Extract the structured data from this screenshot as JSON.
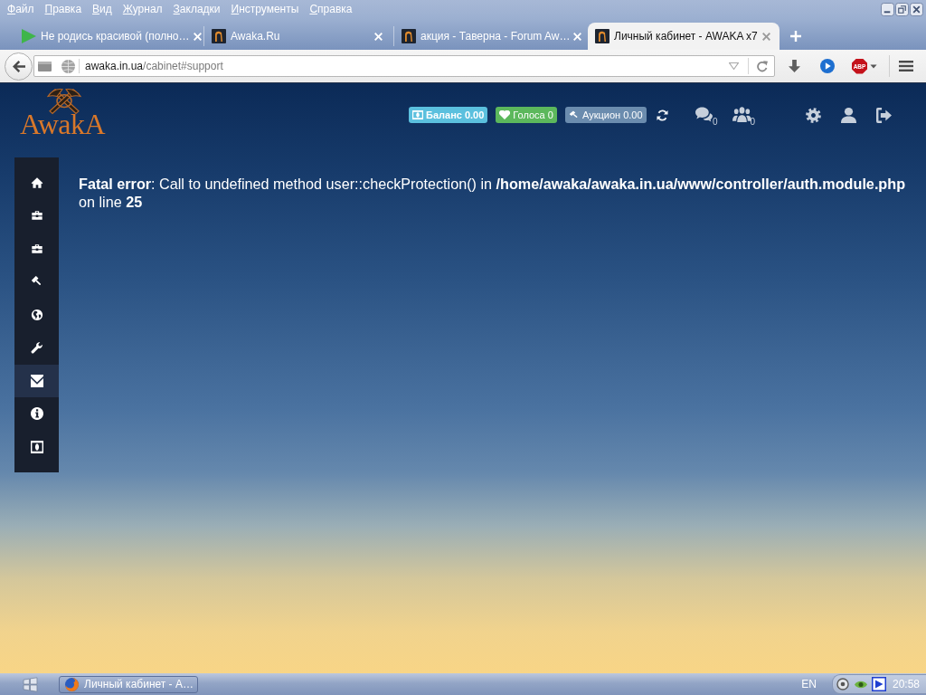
{
  "menu_bar": {
    "items": [
      "Файл",
      "Правка",
      "Вид",
      "Журнал",
      "Закладки",
      "Инструменты",
      "Справка"
    ]
  },
  "tabs": [
    {
      "title": "Не родись красивой (полно…",
      "kind": "media",
      "selected": false
    },
    {
      "title": "Awaka.Ru",
      "kind": "site",
      "selected": false
    },
    {
      "title": "акция - Таверна - Forum Aw…",
      "kind": "site",
      "selected": false
    },
    {
      "title": "Личный кабинет - AWAKA x7",
      "kind": "site",
      "selected": true
    }
  ],
  "address_bar": {
    "host": "awaka.in.ua",
    "path": "/cabinet#support"
  },
  "toolbar": {
    "adblock_label": "ABP"
  },
  "site": {
    "logo": "AwakA",
    "badges": [
      {
        "kind": "balance",
        "label": "Баланс 0.00",
        "color": "#5bc0de"
      },
      {
        "kind": "votes",
        "label": "Голоса 0",
        "color": "#5cb85c"
      },
      {
        "kind": "auction",
        "label": "Аукцион 0.00",
        "color": "#6b8cae"
      }
    ],
    "notifications": [
      {
        "kind": "messages",
        "count": "0"
      },
      {
        "kind": "friends",
        "count": "0"
      }
    ],
    "sidebar": {
      "items": [
        {
          "kind": "home",
          "selected": false
        },
        {
          "kind": "briefcase",
          "selected": false
        },
        {
          "kind": "briefcase",
          "selected": false
        },
        {
          "kind": "gavel",
          "selected": false
        },
        {
          "kind": "globe",
          "selected": false
        },
        {
          "kind": "wrench",
          "selected": false
        },
        {
          "kind": "envelope",
          "selected": true
        },
        {
          "kind": "info",
          "selected": false
        },
        {
          "kind": "money",
          "selected": false
        }
      ]
    },
    "error": "**Fatal error**: Call to undefined method user::checkProtection() in **/home/awaka/awaka.in.ua/www/controller/auth.module.php** on line **25**"
  },
  "taskbar": {
    "tasks": [
      {
        "label": "Личный кабинет - А…"
      }
    ],
    "language": "EN",
    "clock": "20:58"
  }
}
